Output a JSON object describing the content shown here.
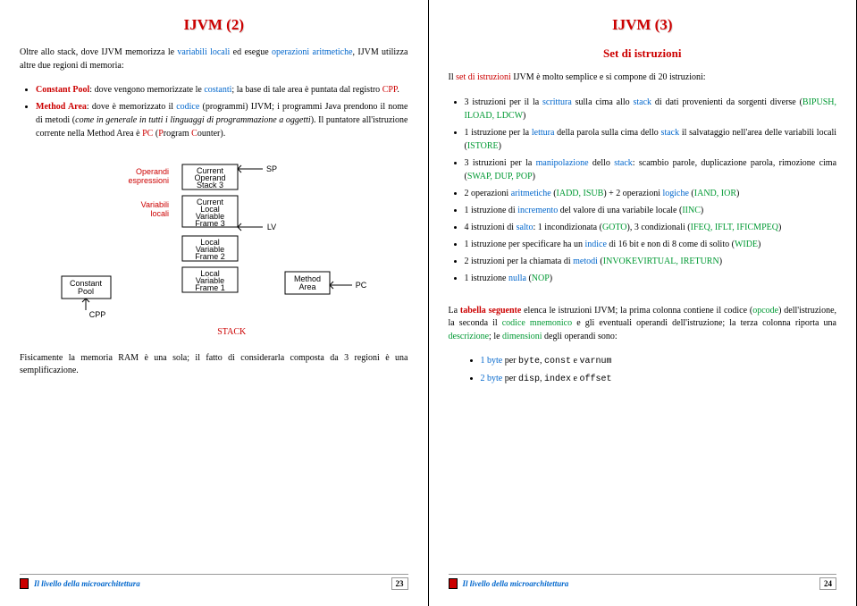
{
  "left": {
    "title": "IJVM (2)",
    "intro": "Oltre allo stack, dove IJVM memorizza le ",
    "intro2": " ed esegue ",
    "intro3": ", IJVM utilizza altre due regioni di memoria:",
    "varLocali": "variabili locali",
    "opArit": "operazioni aritmetiche",
    "b1a": "Constant Pool",
    "b1b": ": dove vengono memorizzate le ",
    "b1c": "costanti",
    "b1d": "; la base di tale area è puntata dal registro ",
    "b1e": "CPP",
    "b1f": ".",
    "b2a": "Method Area",
    "b2b": ": dove è memorizzato il ",
    "b2c": "codice",
    "b2d": " (programmi) IJVM; i programmi Java prendono il nome di metodi (",
    "b2e": "come in generale in tutti i linguaggi di programmazione a oggetti",
    "b2f": "). Il puntatore all'istruzione corrente nella Method Area è ",
    "b2g": "PC",
    "b2h": " (",
    "b2i": "P",
    "b2j": "rogram ",
    "b2k": "C",
    "b2l": "ounter).",
    "opEsp1": "Operandi",
    "opEsp2": "espressioni",
    "varLoc1": "Variabili",
    "varLoc2": "locali",
    "stackLbl": "STACK",
    "closing": "Fisicamente la memoria RAM è una sola; il fatto di considerarla composta da 3 regioni è una semplificazione.",
    "footer": "Il livello della microarchitettura",
    "page": "23",
    "dg": {
      "cp": "Constant Pool",
      "cpp": "CPP",
      "cos": "Current Operand Stack 3",
      "clv": "Current Local Variable Frame 3",
      "lv2": "Local Variable Frame 2",
      "lv1": "Local Variable Frame 1",
      "ma": "Method Area",
      "sp": "SP",
      "lv": "LV",
      "pc": "PC"
    }
  },
  "right": {
    "title": "IJVM (3)",
    "subtitle": "Set di istruzioni",
    "intro1": "Il ",
    "intro2": "set di istruzioni",
    "intro3": " IJVM è molto semplice e si compone di 20 istruzioni:",
    "items": [
      {
        "a": "3 istruzioni per il la ",
        "b": "scrittura",
        "c": " sulla cima allo ",
        "d": "stack",
        "e": " di dati provenienti da sorgenti diverse (",
        "f": "BIPUSH, ILOAD, LDCW",
        "g": ")"
      },
      {
        "a": "1 istruzione per la ",
        "b": "lettura",
        "c": " della parola sulla cima dello ",
        "d": "stack",
        "e": " il salvataggio nell'area delle variabili locali (",
        "f": "ISTORE",
        "g": ")"
      },
      {
        "a": "3 istruzioni per la ",
        "b": "manipolazione",
        "c": " dello ",
        "d": "stack",
        "e": ": scambio parole, duplicazione parola, rimozione cima (",
        "f": "SWAP, DUP, POP",
        "g": ")"
      },
      {
        "a": "2 operazioni ",
        "b": "aritmetiche",
        "c": " (",
        "f": "IADD, ISUB",
        "g": ") + 2 operazioni ",
        "h": "logiche",
        "i": " (",
        "j": "IAND, IOR",
        "k": ")"
      },
      {
        "a": "1 istruzione di ",
        "b": "incremento",
        "c": " del valore di una variabile locale (",
        "f": "IINC",
        "g": ")"
      },
      {
        "a": "4 istruzioni di ",
        "b": "salto",
        "c": ": 1 incondizionata (",
        "f": "GOTO",
        "g": "), 3 condizionali (",
        "j": "IFEQ, IFLT, IFICMPEQ",
        "k": ")"
      },
      {
        "a": "1 istruzione per specificare ha un ",
        "b": "indice",
        "c": " di 16 bit e non di 8 come di solito (",
        "f": "WIDE",
        "g": ")"
      },
      {
        "a": "2 istruzioni per la chiamata di ",
        "b": "metodi",
        "c": " (",
        "f": "INVOKEVIRTUAL, IRETURN",
        "g": ")"
      },
      {
        "a": "1 istruzione ",
        "b": "nulla",
        "c": " (",
        "f": "NOP",
        "g": ")"
      }
    ],
    "tab1": "La ",
    "tab2": "tabella seguente",
    "tab3": " elenca le istruzioni IJVM; la prima colonna contiene il codice (",
    "tab4": "opcode",
    "tab5": ") dell'istruzione, la seconda il ",
    "tab6": "codice mnemonico",
    "tab7": " e gli eventuali operandi dell'istruzione; la terza colonna riporta una ",
    "tab8": "descrizione",
    "tab9": "; le ",
    "tab10": "dimensioni",
    "tab11": " degli operandi sono:",
    "dim1a": "1 byte",
    "dim1b": " per ",
    "dim1c": "byte",
    "dim1d": ", ",
    "dim1e": "const",
    "dim1f": " e ",
    "dim1g": "varnum",
    "dim2a": "2 byte",
    "dim2b": " per ",
    "dim2c": "disp",
    "dim2d": ", ",
    "dim2e": "index",
    "dim2f": " e ",
    "dim2g": "offset",
    "footer": "Il livello della microarchitettura",
    "page": "24"
  }
}
